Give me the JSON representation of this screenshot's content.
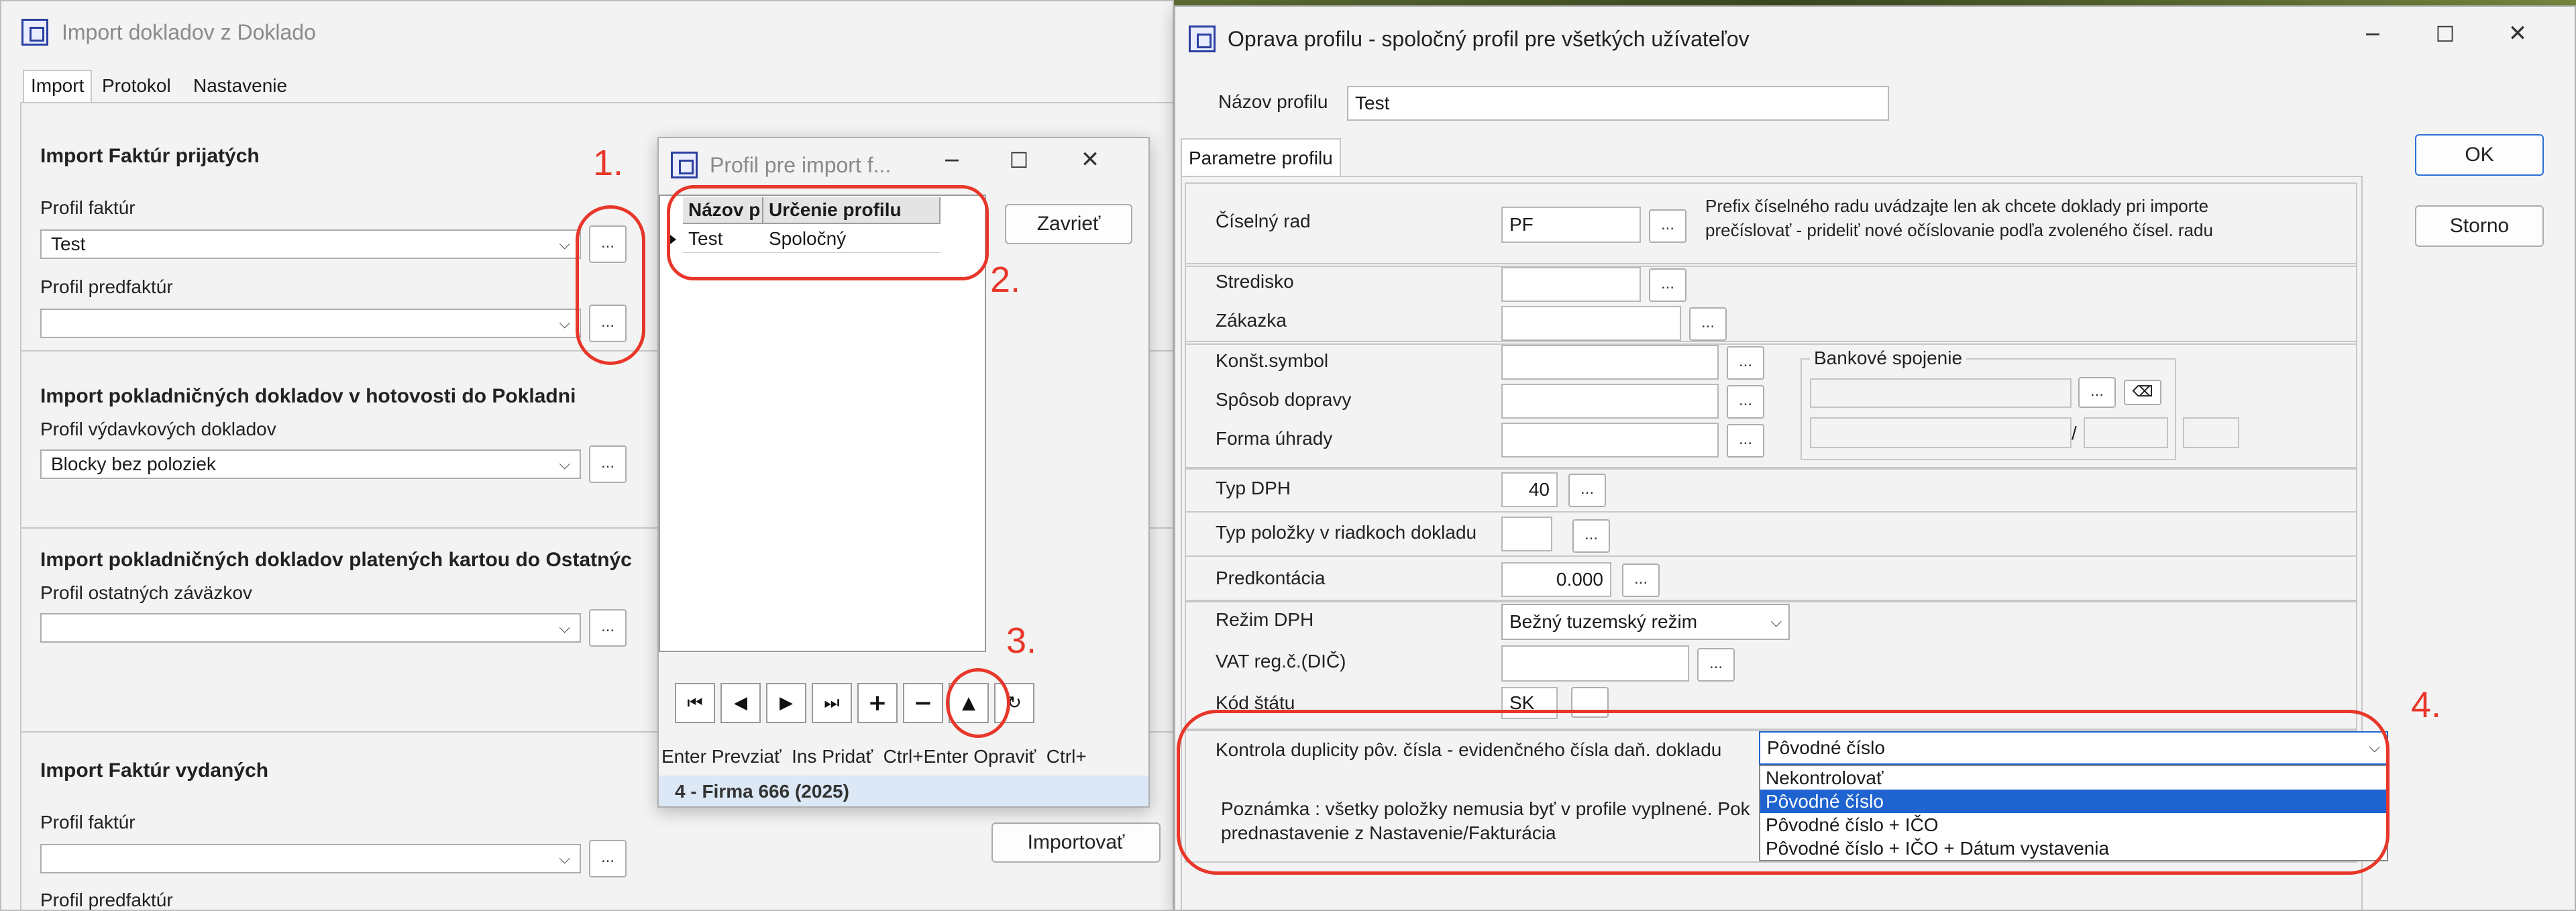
{
  "win1": {
    "title": "Import dokladov z Doklado",
    "tabs": [
      "Import",
      "Protokol",
      "Nastavenie"
    ],
    "section_fp": "Import Faktúr prijatých",
    "profil_faktur_label": "Profil faktúr",
    "profil_faktur_value": "Test",
    "profil_predfaktur_label": "Profil predfaktúr",
    "section_pokl": "Import pokladničných dokladov v hotovosti do Pokladni",
    "profil_vydavkovych_label": "Profil výdavkových dokladov",
    "profil_vydavkovych_value": "Blocky bez poloziek",
    "section_karta": "Import pokladničných dokladov platených kartou do Ostatnýc",
    "profil_ostatnych_label": "Profil ostatných záväzkov",
    "section_fv": "Import Faktúr vydaných",
    "profil_faktur2_label": "Profil faktúr",
    "profil_predfaktur2_label": "Profil predfaktúr",
    "importovat": "Importovať",
    "dots": "..."
  },
  "win2": {
    "title": "Profil pre import f...",
    "col_nazov": "Názov p",
    "col_urcenie": "Určenie profilu",
    "row_nazov": "Test",
    "row_urcenie": "Spoločný",
    "zavriet": "Zavrieť",
    "hints": "Enter Prevziať  Ins Pridať  Ctrl+Enter Opraviť  Ctrl+",
    "status": "4 - Firma 666 (2025)",
    "nav": [
      "⏮",
      "◀",
      "▶",
      "⏭",
      "+",
      "−",
      "▲",
      "↻"
    ]
  },
  "win3": {
    "title": "Oprava profilu - spoločný profil pre všetkých užívateľov",
    "nazov_label": "Názov profilu",
    "nazov_value": "Test",
    "tab": "Parametre profilu",
    "ok": "OK",
    "storno": "Storno",
    "ciselny_rad_label": "Číselný rad",
    "ciselny_rad_value": "PF",
    "ciselny_rad_note1": "Prefix číselného radu uvádzajte len ak chcete doklady pri importe",
    "ciselny_rad_note2": "prečíslovať - prideliť nové očíslovanie podľa zvoleného čísel. radu",
    "stredisko_label": "Stredisko",
    "zakazka_label": "Zákazka",
    "konst_label": "Konšt.symbol",
    "sposob_label": "Spôsob dopravy",
    "forma_label": "Forma úhrady",
    "bankove_label": "Bankové spojenie",
    "slash": "/",
    "typ_dph_label": "Typ DPH",
    "typ_dph_value": "40",
    "typ_polozky_label": "Typ položky v riadkoch dokladu",
    "predkontacia_label": "Predkontácia",
    "predkontacia_value": "0.000",
    "rezim_label": "Režim DPH",
    "rezim_value": "Bežný tuzemský režim",
    "vat_label": "VAT reg.č.(DIČ)",
    "kod_label": "Kód štátu",
    "kod_value": "SK",
    "kontrola_label": "Kontrola duplicity pôv. čísla - evidenčného čísla daň. dokladu",
    "kontrola_value": "Pôvodné číslo",
    "options": [
      "Nekontrolovať",
      "Pôvodné číslo",
      "Pôvodné číslo + IČO",
      "Pôvodné číslo + IČO + Dátum vystavenia"
    ],
    "poznamka1": "Poznámka : všetky položky nemusia byť v profile vyplnené. Pok",
    "poznamka2": "prednastavenie z Nastavenie/Fakturácia",
    "dots": "..."
  },
  "annotations": [
    "1.",
    "2.",
    "3.",
    "4."
  ],
  "colors": {
    "annotation": "#e8372a",
    "selection": "#1e63d0",
    "status_bar": "#dce8f5"
  }
}
